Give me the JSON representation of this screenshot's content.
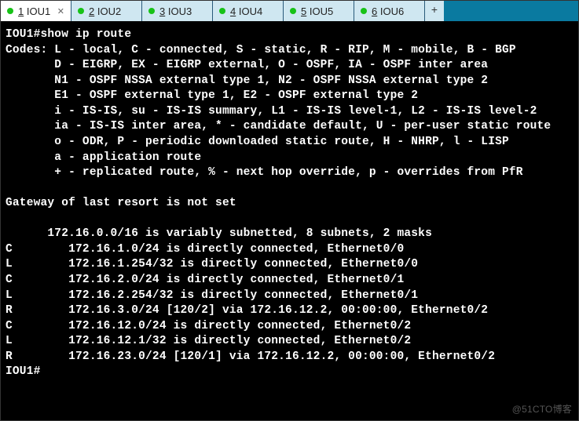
{
  "tabs": [
    {
      "num": "1",
      "name": "IOU1",
      "active": true,
      "close": true
    },
    {
      "num": "2",
      "name": "IOU2",
      "active": false,
      "close": false
    },
    {
      "num": "3",
      "name": "IOU3",
      "active": false,
      "close": false
    },
    {
      "num": "4",
      "name": "IOU4",
      "active": false,
      "close": false
    },
    {
      "num": "5",
      "name": "IOU5",
      "active": false,
      "close": false
    },
    {
      "num": "6",
      "name": "IOU6",
      "active": false,
      "close": false
    }
  ],
  "new_tab_label": "+",
  "terminal_lines": [
    "IOU1#show ip route",
    "Codes: L - local, C - connected, S - static, R - RIP, M - mobile, B - BGP",
    "       D - EIGRP, EX - EIGRP external, O - OSPF, IA - OSPF inter area",
    "       N1 - OSPF NSSA external type 1, N2 - OSPF NSSA external type 2",
    "       E1 - OSPF external type 1, E2 - OSPF external type 2",
    "       i - IS-IS, su - IS-IS summary, L1 - IS-IS level-1, L2 - IS-IS level-2",
    "       ia - IS-IS inter area, * - candidate default, U - per-user static route",
    "       o - ODR, P - periodic downloaded static route, H - NHRP, l - LISP",
    "       a - application route",
    "       + - replicated route, % - next hop override, p - overrides from PfR",
    "",
    "Gateway of last resort is not set",
    "",
    "      172.16.0.0/16 is variably subnetted, 8 subnets, 2 masks",
    "C        172.16.1.0/24 is directly connected, Ethernet0/0",
    "L        172.16.1.254/32 is directly connected, Ethernet0/0",
    "C        172.16.2.0/24 is directly connected, Ethernet0/1",
    "L        172.16.2.254/32 is directly connected, Ethernet0/1",
    "R        172.16.3.0/24 [120/2] via 172.16.12.2, 00:00:00, Ethernet0/2",
    "C        172.16.12.0/24 is directly connected, Ethernet0/2",
    "L        172.16.12.1/32 is directly connected, Ethernet0/2",
    "R        172.16.23.0/24 [120/1] via 172.16.12.2, 00:00:00, Ethernet0/2",
    "IOU1#"
  ],
  "watermark": "@51CTO博客"
}
